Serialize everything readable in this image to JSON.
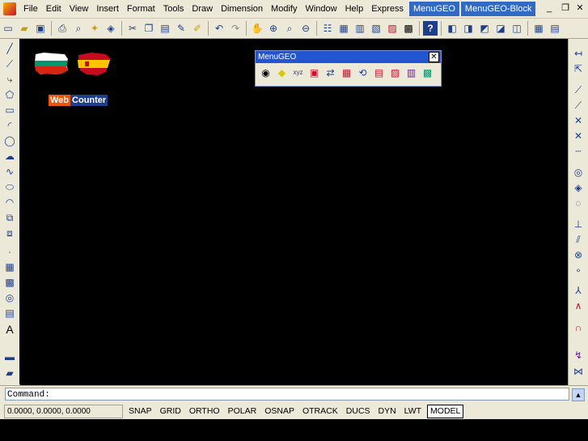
{
  "menubar": {
    "items": [
      "File",
      "Edit",
      "View",
      "Insert",
      "Format",
      "Tools",
      "Draw",
      "Dimension",
      "Modify",
      "Window",
      "Help",
      "Express"
    ],
    "active_items": [
      "MenuGEO",
      "MenuGEO-Block"
    ],
    "window_controls": {
      "minimize": "_",
      "restore": "❐",
      "close": "✕"
    }
  },
  "toolbar": {
    "icons": [
      "new-icon",
      "open-icon",
      "save-icon",
      "plot-icon",
      "preview-icon",
      "publish-icon",
      "3d-dwf-icon",
      "cut-icon",
      "copy-icon",
      "paste-icon",
      "matchprop-icon",
      "blockeditor-icon",
      "undo-icon",
      "redo-icon",
      "pan-icon",
      "zoom-realtime-icon",
      "zoom-window-icon",
      "zoom-previous-icon",
      "properties-icon",
      "designcenter-icon",
      "toolpalettes-icon",
      "sheetset-icon",
      "markup-icon",
      "quickcalc-icon",
      "help-icon",
      "layer-icon",
      "layerstate-icon",
      "layerprev-icon",
      "makecurrent-icon",
      "layer-match-icon",
      "layer-extra-icon"
    ]
  },
  "left_tools": [
    "line",
    "xline",
    "polyline",
    "polygon",
    "rectangle",
    "arc",
    "circle",
    "revcloud",
    "spline",
    "ellipse",
    "ellipse-arc",
    "insert-block",
    "make-block",
    "point",
    "hatch",
    "gradient",
    "region",
    "table",
    "mtext",
    "extra1",
    "extra2"
  ],
  "right_tools": [
    "dim-linear",
    "dim-aligned",
    "dim-arc",
    "dim-ordinate",
    "dim-radius",
    "dim-jogged",
    "dim-diameter",
    "dim-angular",
    "qdim",
    "dim-baseline",
    "dim-continue",
    "qleader",
    "tolerance",
    "center-mark",
    "dim-edit",
    "dim-tedit",
    "dim-update",
    "dim-style",
    "extra-r1"
  ],
  "flags": {
    "bg_colors": [
      "#ffffff",
      "#00966e",
      "#d62612"
    ],
    "es_colors": [
      "#c60b1e",
      "#ffc400"
    ]
  },
  "webcounter": {
    "part1": "Web",
    "part2": "Counter"
  },
  "palette": {
    "title": "MenuGEO",
    "close": "✕",
    "buttons": [
      "◉",
      "◆",
      "xyz",
      "▣",
      "⇄",
      "▦",
      "⟲",
      "▤",
      "▨",
      "▥",
      "▩"
    ]
  },
  "command": {
    "prompt": "Command:"
  },
  "status": {
    "coords": "0.0000,  0.0000, 0.0000",
    "toggles": [
      "SNAP",
      "GRID",
      "ORTHO",
      "POLAR",
      "OSNAP",
      "OTRACK",
      "DUCS",
      "DYN",
      "LWT",
      "MODEL"
    ],
    "active_toggle": "MODEL"
  }
}
